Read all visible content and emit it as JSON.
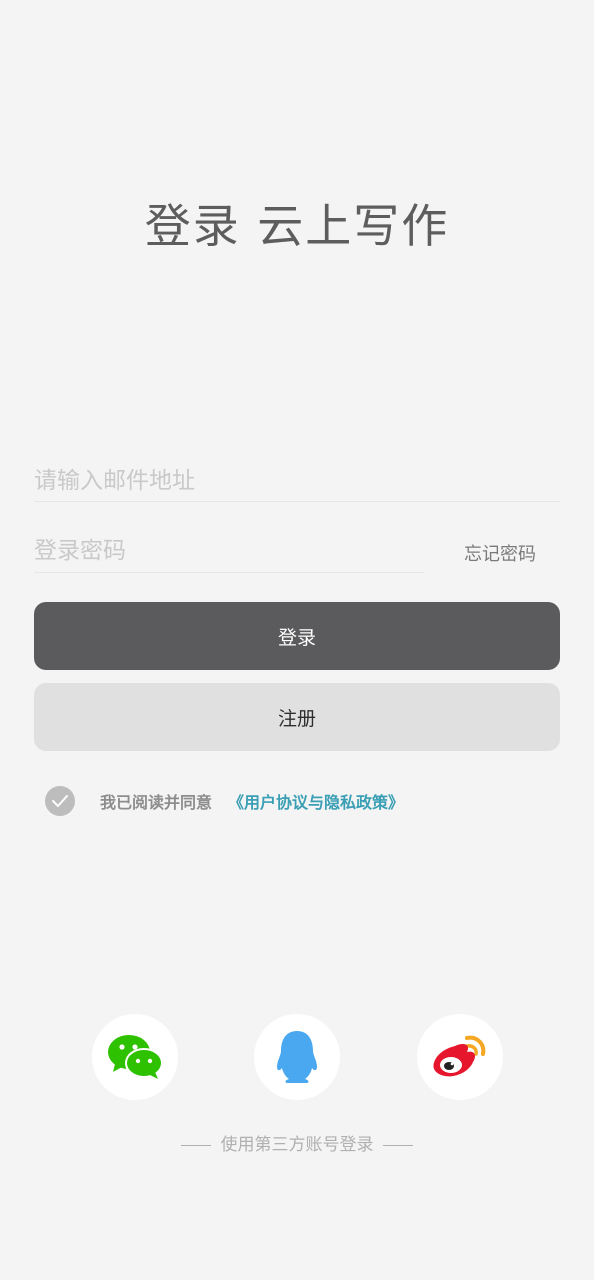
{
  "header": {
    "title": "登录 云上写作"
  },
  "form": {
    "email_placeholder": "请输入邮件地址",
    "password_placeholder": "登录密码",
    "forgot_password": "忘记密码",
    "login_label": "登录",
    "register_label": "注册"
  },
  "agreement": {
    "checked": true,
    "text": "我已阅读并同意",
    "link": "《用户协议与隐私政策》"
  },
  "social": {
    "items": [
      {
        "icon": "wechat-icon",
        "color": "#2dc100"
      },
      {
        "icon": "qq-icon",
        "color": "#4aa8f0"
      },
      {
        "icon": "weibo-icon",
        "color": "#e6162d"
      }
    ],
    "label": "使用第三方账号登录"
  },
  "colors": {
    "background": "#f4f4f4",
    "primary_button": "#5b5b5d",
    "secondary_button": "#e0e0e0",
    "link": "#3a9fb4"
  }
}
